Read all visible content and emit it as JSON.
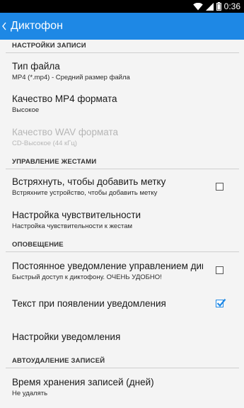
{
  "status_bar": {
    "time": "0:36"
  },
  "action_bar": {
    "title": "Диктофон"
  },
  "sections": {
    "recording": "НАСТРОЙКИ ЗАПИСИ",
    "gestures": "УПРАВЛЕНИЕ ЖЕСТАМИ",
    "notifications": "ОПОВЕЩЕНИЕ",
    "autodelete": "АВТОУДАЛЕНИЕ ЗАПИСЕЙ"
  },
  "prefs": {
    "file_type": {
      "title": "Тип файла",
      "summary": "MP4 (*.mp4) - Средний размер файла"
    },
    "mp4_quality": {
      "title": "Качество MP4 формата",
      "summary": "Высокое"
    },
    "wav_quality": {
      "title": "Качество WAV формата",
      "summary": "CD-Высокое (44 кГц)",
      "enabled": false
    },
    "shake_mark": {
      "title": "Встряхнуть, чтобы добавить метку",
      "summary": "Встряхните устройство, чтобы добавить метку",
      "checked": false
    },
    "sensitivity": {
      "title": "Настройка чувствительности",
      "summary": "Настройка чувствительности к жестам"
    },
    "persistent_notification": {
      "title": "Постоянное уведомление управлением дикт",
      "summary": "Быстрый доступ к диктофону. ОЧЕНЬ УДОБНО!",
      "checked": false
    },
    "notification_text": {
      "title": "Текст при появлении уведомления",
      "checked": true
    },
    "notification_settings": {
      "title": "Настройки уведомления"
    },
    "retention": {
      "title": "Время хранения записей (дней)",
      "summary": "Не удалять"
    }
  },
  "colors": {
    "action_bar": "#1e88e5",
    "status_bar": "#000000",
    "background": "#f4f4f4",
    "checkbox_accent": "#1e88e5"
  }
}
